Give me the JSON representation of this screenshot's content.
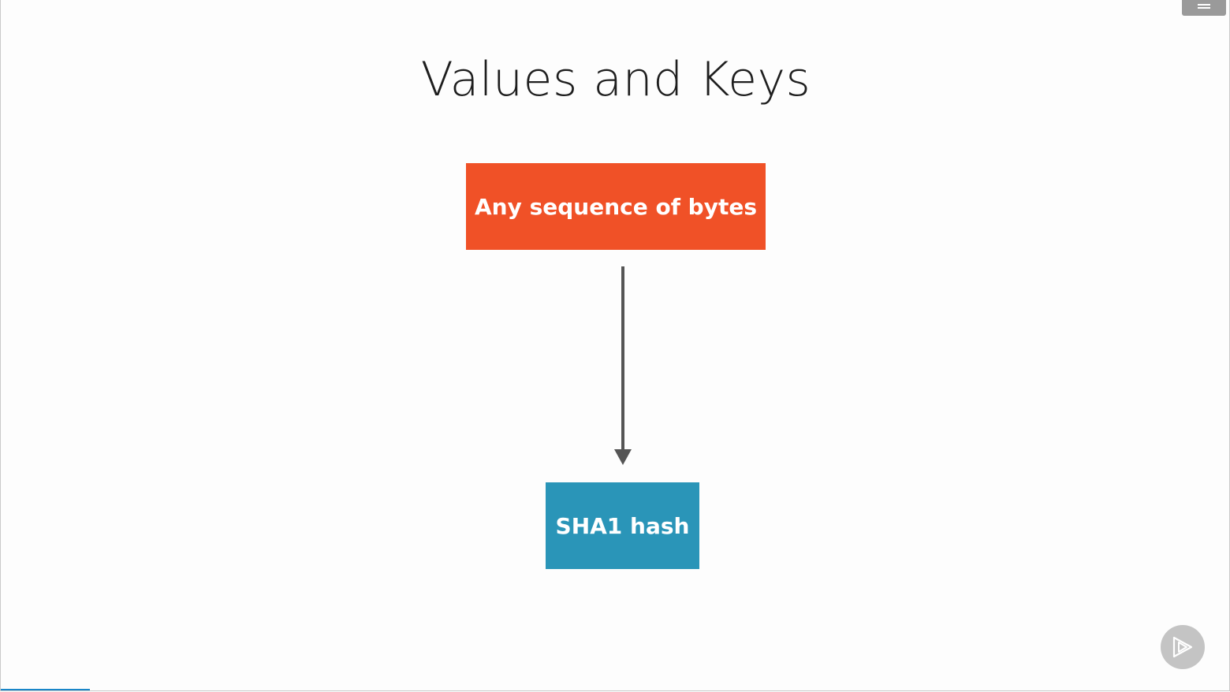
{
  "slide": {
    "title": "Values and Keys"
  },
  "diagram": {
    "source_box": {
      "label": "Any sequence of bytes",
      "color": "#f05127"
    },
    "target_box": {
      "label": "SHA1 hash",
      "color": "#2a95b8"
    },
    "arrow_color": "#555555"
  },
  "icons": {
    "menu": "menu-icon",
    "player": "play-logo-icon"
  },
  "player": {
    "progress_color": "#1a86c8"
  }
}
